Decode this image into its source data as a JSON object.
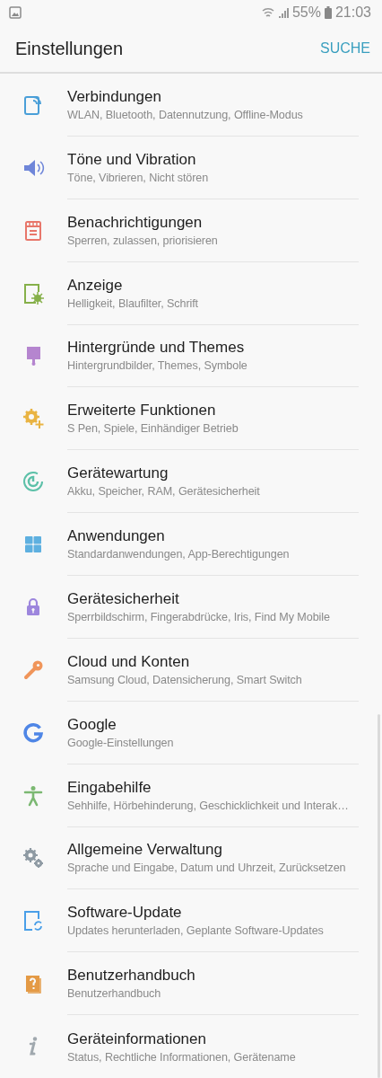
{
  "status_bar": {
    "battery": "55%",
    "time": "21:03"
  },
  "header": {
    "title": "Einstellungen",
    "action": "SUCHE"
  },
  "items": [
    {
      "title": "Verbindungen",
      "subtitle": "WLAN, Bluetooth, Datennutzung, Offline-Modus",
      "color": "#4a9fd8"
    },
    {
      "title": "Töne und Vibration",
      "subtitle": "Töne, Vibrieren, Nicht stören",
      "color": "#6f86d9"
    },
    {
      "title": "Benachrichtigungen",
      "subtitle": "Sperren, zulassen, priorisieren",
      "color": "#e8776b"
    },
    {
      "title": "Anzeige",
      "subtitle": "Helligkeit, Blaufilter, Schrift",
      "color": "#86b04a"
    },
    {
      "title": "Hintergründe und Themes",
      "subtitle": "Hintergrundbilder, Themes, Symbole",
      "color": "#b585cf"
    },
    {
      "title": "Erweiterte Funktionen",
      "subtitle": "S Pen, Spiele, Einhändiger Betrieb",
      "color": "#e9b443"
    },
    {
      "title": "Gerätewartung",
      "subtitle": "Akku, Speicher, RAM, Gerätesicherheit",
      "color": "#5cc0a8"
    },
    {
      "title": "Anwendungen",
      "subtitle": "Standardanwendungen, App-Berechtigungen",
      "color": "#5eb0e0"
    },
    {
      "title": "Gerätesicherheit",
      "subtitle": "Sperrbildschirm, Fingerabdrücke, Iris, Find My Mobile",
      "color": "#9d86dd"
    },
    {
      "title": "Cloud und Konten",
      "subtitle": "Samsung Cloud, Datensicherung, Smart Switch",
      "color": "#f0955a"
    },
    {
      "title": "Google",
      "subtitle": "Google-Einstellungen",
      "color": "#4f86e6"
    },
    {
      "title": "Eingabehilfe",
      "subtitle": "Sehhilfe, Hörbehinderung, Geschicklichkeit und Interak…",
      "color": "#7bb872"
    },
    {
      "title": "Allgemeine Verwaltung",
      "subtitle": "Sprache und Eingabe, Datum und Uhrzeit, Zurücksetzen",
      "color": "#8e9aa3"
    },
    {
      "title": "Software-Update",
      "subtitle": "Updates herunterladen, Geplante Software-Updates",
      "color": "#4a9fe8"
    },
    {
      "title": "Benutzerhandbuch",
      "subtitle": "Benutzerhandbuch",
      "color": "#e49a45"
    },
    {
      "title": "Geräteinformationen",
      "subtitle": "Status, Rechtliche Informationen, Gerätename",
      "color": "#a0a8ae"
    }
  ]
}
